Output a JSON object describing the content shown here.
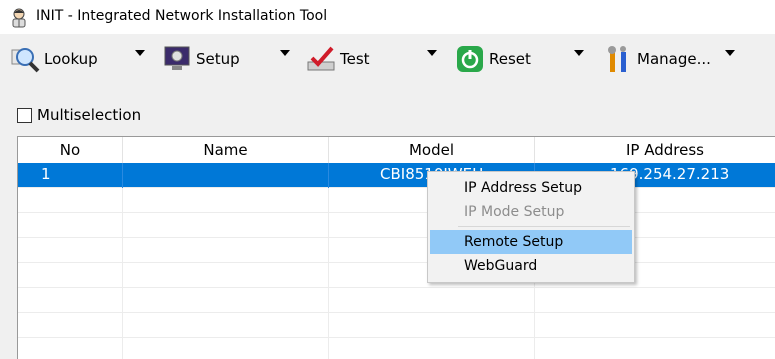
{
  "window": {
    "title": "INIT - Integrated Network Installation Tool",
    "icon": "init-app-icon"
  },
  "toolbar": {
    "lookup": {
      "label": "Lookup",
      "icon": "magnifier-icon"
    },
    "setup": {
      "label": "Setup",
      "icon": "monitor-gear-icon"
    },
    "test": {
      "label": "Test",
      "icon": "checkmark-tray-icon"
    },
    "reset": {
      "label": "Reset",
      "icon": "power-icon"
    },
    "manage": {
      "label": "Manage...",
      "icon": "tools-icon"
    }
  },
  "multiselection": {
    "label": "Multiselection",
    "checked": false
  },
  "table": {
    "columns": [
      "No",
      "Name",
      "Model",
      "IP Address"
    ],
    "rows": [
      {
        "no": "1",
        "name": "",
        "model": "CBI8510IWEH",
        "ip": "169.254.27.213",
        "selected": true
      }
    ]
  },
  "context_menu": {
    "items": [
      {
        "label": "IP Address Setup",
        "enabled": true
      },
      {
        "label": "IP Mode Setup",
        "enabled": false
      },
      {
        "label": "Remote Setup",
        "enabled": true,
        "highlighted": true
      },
      {
        "label": "WebGuard",
        "enabled": true
      }
    ]
  },
  "colors": {
    "selection": "#0078d7",
    "menu_highlight": "#91c9f7",
    "reset_green": "#2aa84a"
  }
}
